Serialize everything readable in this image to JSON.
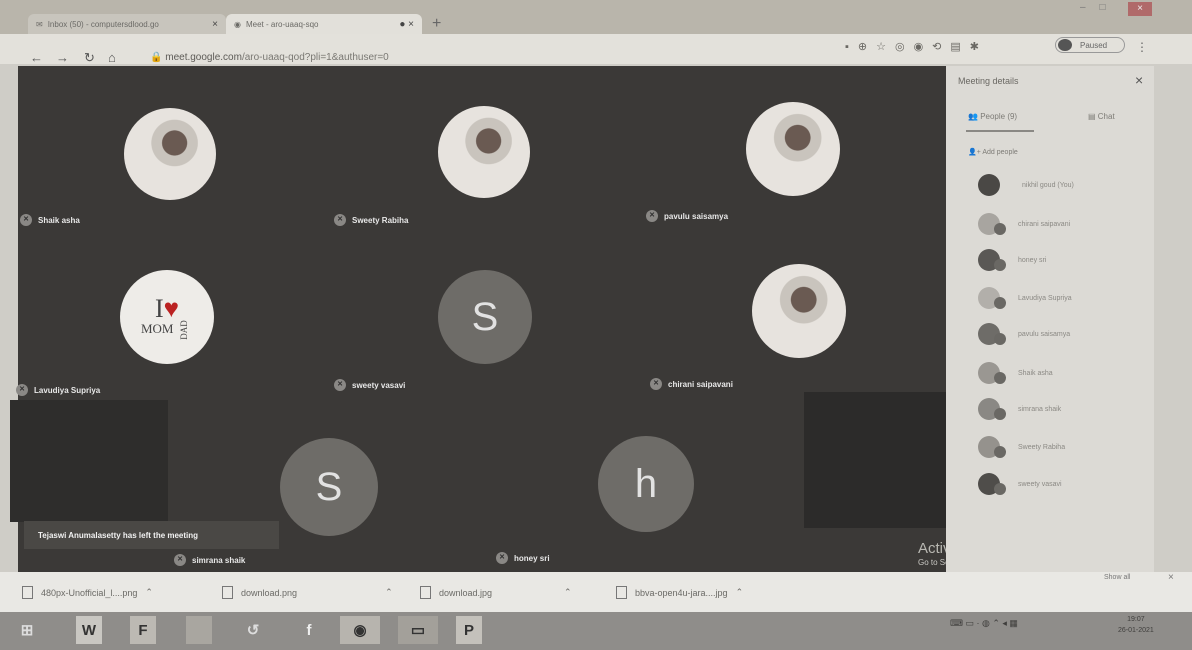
{
  "browser": {
    "tabs": [
      {
        "label": "Inbox (50) - computersdlood.go"
      },
      {
        "label": "Meet - aro-uaaq-sqo"
      }
    ],
    "new_tab": "+",
    "url_host": "meet.google.com",
    "url_path": "/aro-uaaq-qod?pli=1&authuser=0",
    "profile_label": "Paused"
  },
  "meeting": {
    "tiles": [
      {
        "name": "Shaik asha"
      },
      {
        "name": "Sweety Rabiha"
      },
      {
        "name": "pavulu saisamya"
      },
      {
        "name": "Lavudiya Supriya"
      },
      {
        "name": "sweety vasavi",
        "letter": "S"
      },
      {
        "name": "chirani saipavani"
      },
      {
        "name": "simrana shaik",
        "letter": "S"
      },
      {
        "name": "honey sri",
        "letter": "h"
      }
    ],
    "mom_dad_logo": {
      "i": "I",
      "mom": "MOM",
      "dad": "DAD"
    },
    "toast": "Tejaswi Anumalasetty has left the meeting",
    "watermark": "Activate Windows",
    "watermark_sub": "Go to Settings to activate Windows."
  },
  "panel": {
    "title": "Meeting details",
    "close": "×",
    "tab_people": "People (9)",
    "tab_chat": "Chat",
    "add_people": "Add people",
    "people": [
      {
        "name": "nikhil goud (You)"
      },
      {
        "name": "chirani saipavani"
      },
      {
        "name": "honey sri"
      },
      {
        "name": "Lavudiya Supriya"
      },
      {
        "name": "pavulu saisamya"
      },
      {
        "name": "Shaik asha"
      },
      {
        "name": "simrana shaik"
      },
      {
        "name": "Sweety Rabiha"
      },
      {
        "name": "sweety vasavi"
      }
    ]
  },
  "downloads": {
    "items": [
      {
        "name": "480px-Unofficial_l....png"
      },
      {
        "name": "download.png"
      },
      {
        "name": "download.jpg"
      },
      {
        "name": "bbva-open4u-jara....jpg"
      }
    ],
    "show_all": "Show all",
    "close": "×"
  },
  "taskbar": {
    "apps": [
      "W",
      "F",
      "f",
      "P"
    ],
    "time": "19:07",
    "date": "26-01-2021"
  },
  "colors": {
    "meet_bg": "#3b3937",
    "letter_avatar": "#6e6c68",
    "panel_bg": "#dcdad5"
  }
}
